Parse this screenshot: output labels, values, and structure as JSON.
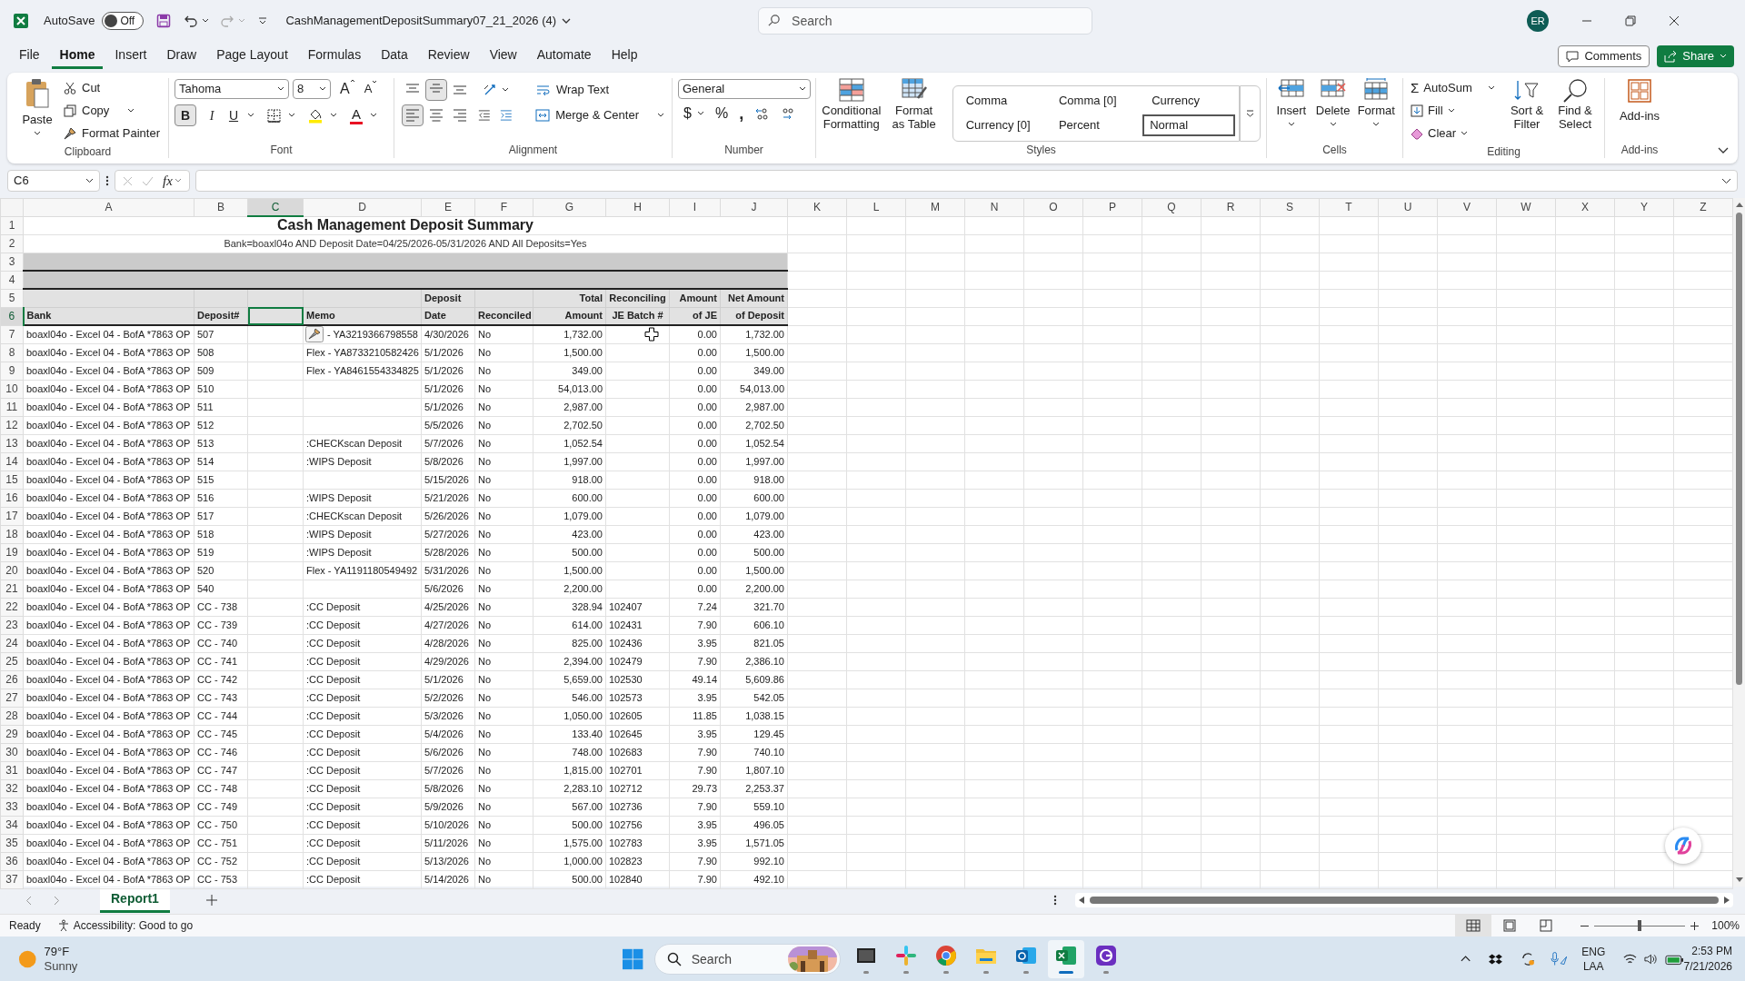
{
  "title_bar": {
    "autosave_label": "AutoSave",
    "autosave_state": "Off",
    "autosave_on": false,
    "file_name": "CashManagementDepositSummary07_21_2026 (4)",
    "search_placeholder": "Search",
    "user_initials": "ER"
  },
  "menu_tabs": [
    {
      "label": "File",
      "selected": false
    },
    {
      "label": "Home",
      "selected": true
    },
    {
      "label": "Insert",
      "selected": false
    },
    {
      "label": "Draw",
      "selected": false
    },
    {
      "label": "Page Layout",
      "selected": false
    },
    {
      "label": "Formulas",
      "selected": false
    },
    {
      "label": "Data",
      "selected": false
    },
    {
      "label": "Review",
      "selected": false
    },
    {
      "label": "View",
      "selected": false
    },
    {
      "label": "Automate",
      "selected": false
    },
    {
      "label": "Help",
      "selected": false
    }
  ],
  "header_buttons": {
    "comments": "Comments",
    "share": "Share"
  },
  "ribbon": {
    "clipboard": {
      "label": "Clipboard",
      "paste": "Paste",
      "cut": "Cut",
      "copy": "Copy",
      "format_painter": "Format Painter"
    },
    "font": {
      "label": "Font",
      "font_name": "Tahoma",
      "font_size": "8",
      "grow_glyph": "A",
      "shrink_glyph": "A",
      "bold": {
        "glyph": "B",
        "on": true
      },
      "italic_glyph": "I",
      "underline_glyph": "U",
      "color_glyph": "A"
    },
    "alignment": {
      "label": "Alignment",
      "vertical_align": [
        {
          "selected": false
        },
        {
          "selected": true
        },
        {
          "selected": false
        }
      ],
      "horizontal_align": [
        {
          "selected": true
        },
        {
          "selected": false
        },
        {
          "selected": false
        }
      ],
      "wrap_text": "Wrap Text",
      "merge_center": "Merge & Center"
    },
    "number": {
      "label": "Number",
      "format": "General",
      "currency_glyph": "$",
      "percent_glyph": "%",
      "comma_glyph": ","
    },
    "styles": {
      "label": "Styles",
      "conditional_formatting": "Conditional Formatting",
      "format_as_table": "Format as Table",
      "gallery": [
        {
          "label": "Comma",
          "selected": false
        },
        {
          "label": "Comma [0]",
          "selected": false
        },
        {
          "label": "Currency",
          "selected": false
        },
        {
          "label": "Currency [0]",
          "selected": false
        },
        {
          "label": "Percent",
          "selected": false
        },
        {
          "label": "Normal",
          "selected": true
        }
      ]
    },
    "cells": {
      "label": "Cells",
      "insert": "Insert",
      "delete": "Delete",
      "format": "Format"
    },
    "editing": {
      "label": "Editing",
      "autosum_glyph": "Σ",
      "autosum": "AutoSum",
      "fill": "Fill",
      "clear": "Clear",
      "sort_filter": "Sort & Filter",
      "find_select": "Find & Select"
    },
    "add_ins": {
      "label": "Add-ins",
      "add_ins": "Add-ins"
    }
  },
  "formula_bar": {
    "name_box": "C6",
    "fx_glyph": "fx"
  },
  "columns": [
    {
      "label": "A",
      "selected": false
    },
    {
      "label": "B",
      "selected": false
    },
    {
      "label": "C",
      "selected": true
    },
    {
      "label": "D",
      "selected": false
    },
    {
      "label": "E",
      "selected": false
    },
    {
      "label": "F",
      "selected": false
    },
    {
      "label": "G",
      "selected": false
    },
    {
      "label": "H",
      "selected": false
    },
    {
      "label": "I",
      "selected": false
    },
    {
      "label": "J",
      "selected": false
    },
    {
      "label": "K",
      "selected": false
    },
    {
      "label": "L",
      "selected": false
    },
    {
      "label": "M",
      "selected": false
    },
    {
      "label": "N",
      "selected": false
    },
    {
      "label": "O",
      "selected": false
    },
    {
      "label": "P",
      "selected": false
    },
    {
      "label": "Q",
      "selected": false
    },
    {
      "label": "R",
      "selected": false
    },
    {
      "label": "S",
      "selected": false
    },
    {
      "label": "T",
      "selected": false
    },
    {
      "label": "U",
      "selected": false
    },
    {
      "label": "V",
      "selected": false
    },
    {
      "label": "W",
      "selected": false
    },
    {
      "label": "X",
      "selected": false
    },
    {
      "label": "Y",
      "selected": false
    },
    {
      "label": "Z",
      "selected": false
    }
  ],
  "rows": [
    {
      "kind": "title",
      "n": "1",
      "selected": false,
      "text": "Cash Management Deposit Summary"
    },
    {
      "kind": "subtitle",
      "n": "2",
      "selected": false,
      "text": "Bank=boaxl04o  AND Deposit Date=04/25/2026-05/31/2026  AND All Deposits=Yes"
    },
    {
      "kind": "band",
      "n": "3",
      "selected": false
    },
    {
      "kind": "band",
      "n": "4",
      "selected": false
    },
    {
      "kind": "header",
      "n": "5",
      "selected": false,
      "e": "Deposit",
      "g": "Total",
      "h": "Reconciling",
      "i": "Amount",
      "j": "Net Amount"
    },
    {
      "kind": "header",
      "n": "6",
      "selected": true,
      "a": "Bank",
      "b": "Deposit#",
      "d": "Memo",
      "e": "Date",
      "f": "Reconciled",
      "g": "Amount",
      "h": "JE Batch #",
      "i": "of JE",
      "j": "of Deposit"
    },
    {
      "kind": "data",
      "n": "7",
      "selected": false,
      "memo_icon": true,
      "a": "boaxl04o - Excel 04 - BofA *7863 OP",
      "b": "507",
      "d": "- YA3219366798558",
      "e": "4/30/2026",
      "f": "No",
      "g": "1,732.00",
      "i": "0.00",
      "j": "1,732.00"
    },
    {
      "kind": "data",
      "n": "8",
      "selected": false,
      "a": "boaxl04o - Excel 04 - BofA *7863 OP",
      "b": "508",
      "d": "Flex - YA8733210582426",
      "e": "5/1/2026",
      "f": "No",
      "g": "1,500.00",
      "i": "0.00",
      "j": "1,500.00"
    },
    {
      "kind": "data",
      "n": "9",
      "selected": false,
      "a": "boaxl04o - Excel 04 - BofA *7863 OP",
      "b": "509",
      "d": "Flex - YA8461554334825",
      "e": "5/1/2026",
      "f": "No",
      "g": "349.00",
      "i": "0.00",
      "j": "349.00"
    },
    {
      "kind": "data",
      "n": "10",
      "selected": false,
      "a": "boaxl04o - Excel 04 - BofA *7863 OP",
      "b": "510",
      "e": "5/1/2026",
      "f": "No",
      "g": "54,013.00",
      "i": "0.00",
      "j": "54,013.00"
    },
    {
      "kind": "data",
      "n": "11",
      "selected": false,
      "a": "boaxl04o - Excel 04 - BofA *7863 OP",
      "b": "511",
      "e": "5/1/2026",
      "f": "No",
      "g": "2,987.00",
      "i": "0.00",
      "j": "2,987.00"
    },
    {
      "kind": "data",
      "n": "12",
      "selected": false,
      "a": "boaxl04o - Excel 04 - BofA *7863 OP",
      "b": "512",
      "e": "5/5/2026",
      "f": "No",
      "g": "2,702.50",
      "i": "0.00",
      "j": "2,702.50"
    },
    {
      "kind": "data",
      "n": "13",
      "selected": false,
      "a": "boaxl04o - Excel 04 - BofA *7863 OP",
      "b": "513",
      "d": ":CHECKscan Deposit",
      "e": "5/7/2026",
      "f": "No",
      "g": "1,052.54",
      "i": "0.00",
      "j": "1,052.54"
    },
    {
      "kind": "data",
      "n": "14",
      "selected": false,
      "a": "boaxl04o - Excel 04 - BofA *7863 OP",
      "b": "514",
      "d": ":WIPS Deposit",
      "e": "5/8/2026",
      "f": "No",
      "g": "1,997.00",
      "i": "0.00",
      "j": "1,997.00"
    },
    {
      "kind": "data",
      "n": "15",
      "selected": false,
      "a": "boaxl04o - Excel 04 - BofA *7863 OP",
      "b": "515",
      "e": "5/15/2026",
      "f": "No",
      "g": "918.00",
      "i": "0.00",
      "j": "918.00"
    },
    {
      "kind": "data",
      "n": "16",
      "selected": false,
      "a": "boaxl04o - Excel 04 - BofA *7863 OP",
      "b": "516",
      "d": ":WIPS Deposit",
      "e": "5/21/2026",
      "f": "No",
      "g": "600.00",
      "i": "0.00",
      "j": "600.00"
    },
    {
      "kind": "data",
      "n": "17",
      "selected": false,
      "a": "boaxl04o - Excel 04 - BofA *7863 OP",
      "b": "517",
      "d": ":CHECKscan Deposit",
      "e": "5/26/2026",
      "f": "No",
      "g": "1,079.00",
      "i": "0.00",
      "j": "1,079.00"
    },
    {
      "kind": "data",
      "n": "18",
      "selected": false,
      "a": "boaxl04o - Excel 04 - BofA *7863 OP",
      "b": "518",
      "d": ":WIPS Deposit",
      "e": "5/27/2026",
      "f": "No",
      "g": "423.00",
      "i": "0.00",
      "j": "423.00"
    },
    {
      "kind": "data",
      "n": "19",
      "selected": false,
      "a": "boaxl04o - Excel 04 - BofA *7863 OP",
      "b": "519",
      "d": ":WIPS Deposit",
      "e": "5/28/2026",
      "f": "No",
      "g": "500.00",
      "i": "0.00",
      "j": "500.00"
    },
    {
      "kind": "data",
      "n": "20",
      "selected": false,
      "a": "boaxl04o - Excel 04 - BofA *7863 OP",
      "b": "520",
      "d": "Flex - YA1191180549492",
      "e": "5/31/2026",
      "f": "No",
      "g": "1,500.00",
      "i": "0.00",
      "j": "1,500.00"
    },
    {
      "kind": "data",
      "n": "21",
      "selected": false,
      "a": "boaxl04o - Excel 04 - BofA *7863 OP",
      "b": "540",
      "e": "5/6/2026",
      "f": "No",
      "g": "2,200.00",
      "i": "0.00",
      "j": "2,200.00"
    },
    {
      "kind": "data",
      "n": "22",
      "selected": false,
      "a": "boaxl04o - Excel 04 - BofA *7863 OP",
      "b": "CC - 738",
      "d": ":CC Deposit",
      "e": "4/25/2026",
      "f": "No",
      "g": "328.94",
      "h": "102407",
      "i": "7.24",
      "j": "321.70"
    },
    {
      "kind": "data",
      "n": "23",
      "selected": false,
      "a": "boaxl04o - Excel 04 - BofA *7863 OP",
      "b": "CC - 739",
      "d": ":CC Deposit",
      "e": "4/27/2026",
      "f": "No",
      "g": "614.00",
      "h": "102431",
      "i": "7.90",
      "j": "606.10"
    },
    {
      "kind": "data",
      "n": "24",
      "selected": false,
      "a": "boaxl04o - Excel 04 - BofA *7863 OP",
      "b": "CC - 740",
      "d": ":CC Deposit",
      "e": "4/28/2026",
      "f": "No",
      "g": "825.00",
      "h": "102436",
      "i": "3.95",
      "j": "821.05"
    },
    {
      "kind": "data",
      "n": "25",
      "selected": false,
      "a": "boaxl04o - Excel 04 - BofA *7863 OP",
      "b": "CC - 741",
      "d": ":CC Deposit",
      "e": "4/29/2026",
      "f": "No",
      "g": "2,394.00",
      "h": "102479",
      "i": "7.90",
      "j": "2,386.10"
    },
    {
      "kind": "data",
      "n": "26",
      "selected": false,
      "a": "boaxl04o - Excel 04 - BofA *7863 OP",
      "b": "CC - 742",
      "d": ":CC Deposit",
      "e": "5/1/2026",
      "f": "No",
      "g": "5,659.00",
      "h": "102530",
      "i": "49.14",
      "j": "5,609.86"
    },
    {
      "kind": "data",
      "n": "27",
      "selected": false,
      "a": "boaxl04o - Excel 04 - BofA *7863 OP",
      "b": "CC - 743",
      "d": ":CC Deposit",
      "e": "5/2/2026",
      "f": "No",
      "g": "546.00",
      "h": "102573",
      "i": "3.95",
      "j": "542.05"
    },
    {
      "kind": "data",
      "n": "28",
      "selected": false,
      "a": "boaxl04o - Excel 04 - BofA *7863 OP",
      "b": "CC - 744",
      "d": ":CC Deposit",
      "e": "5/3/2026",
      "f": "No",
      "g": "1,050.00",
      "h": "102605",
      "i": "11.85",
      "j": "1,038.15"
    },
    {
      "kind": "data",
      "n": "29",
      "selected": false,
      "a": "boaxl04o - Excel 04 - BofA *7863 OP",
      "b": "CC - 745",
      "d": ":CC Deposit",
      "e": "5/4/2026",
      "f": "No",
      "g": "133.40",
      "h": "102645",
      "i": "3.95",
      "j": "129.45"
    },
    {
      "kind": "data",
      "n": "30",
      "selected": false,
      "a": "boaxl04o - Excel 04 - BofA *7863 OP",
      "b": "CC - 746",
      "d": ":CC Deposit",
      "e": "5/6/2026",
      "f": "No",
      "g": "748.00",
      "h": "102683",
      "i": "7.90",
      "j": "740.10"
    },
    {
      "kind": "data",
      "n": "31",
      "selected": false,
      "a": "boaxl04o - Excel 04 - BofA *7863 OP",
      "b": "CC - 747",
      "d": ":CC Deposit",
      "e": "5/7/2026",
      "f": "No",
      "g": "1,815.00",
      "h": "102701",
      "i": "7.90",
      "j": "1,807.10"
    },
    {
      "kind": "data",
      "n": "32",
      "selected": false,
      "a": "boaxl04o - Excel 04 - BofA *7863 OP",
      "b": "CC - 748",
      "d": ":CC Deposit",
      "e": "5/8/2026",
      "f": "No",
      "g": "2,283.10",
      "h": "102712",
      "i": "29.73",
      "j": "2,253.37"
    },
    {
      "kind": "data",
      "n": "33",
      "selected": false,
      "a": "boaxl04o - Excel 04 - BofA *7863 OP",
      "b": "CC - 749",
      "d": ":CC Deposit",
      "e": "5/9/2026",
      "f": "No",
      "g": "567.00",
      "h": "102736",
      "i": "7.90",
      "j": "559.10"
    },
    {
      "kind": "data",
      "n": "34",
      "selected": false,
      "a": "boaxl04o - Excel 04 - BofA *7863 OP",
      "b": "CC - 750",
      "d": ":CC Deposit",
      "e": "5/10/2026",
      "f": "No",
      "g": "500.00",
      "h": "102756",
      "i": "3.95",
      "j": "496.05"
    },
    {
      "kind": "data",
      "n": "35",
      "selected": false,
      "a": "boaxl04o - Excel 04 - BofA *7863 OP",
      "b": "CC - 751",
      "d": ":CC Deposit",
      "e": "5/11/2026",
      "f": "No",
      "g": "1,575.00",
      "h": "102783",
      "i": "3.95",
      "j": "1,571.05"
    },
    {
      "kind": "data",
      "n": "36",
      "selected": false,
      "a": "boaxl04o - Excel 04 - BofA *7863 OP",
      "b": "CC - 752",
      "d": ":CC Deposit",
      "e": "5/13/2026",
      "f": "No",
      "g": "1,000.00",
      "h": "102823",
      "i": "7.90",
      "j": "992.10"
    },
    {
      "kind": "data",
      "n": "37",
      "selected": false,
      "a": "boaxl04o - Excel 04 - BofA *7863 OP",
      "b": "CC - 753",
      "d": ":CC Deposit",
      "e": "5/14/2026",
      "f": "No",
      "g": "500.00",
      "h": "102840",
      "i": "7.90",
      "j": "492.10"
    }
  ],
  "sheet_tabs": [
    {
      "label": "Report1",
      "selected": true
    }
  ],
  "status_bar": {
    "ready": "Ready",
    "accessibility": "Accessibility: Good to go",
    "views": [
      {
        "selected": true
      },
      {
        "selected": false
      },
      {
        "selected": false
      }
    ],
    "zoom": {
      "level": 0.5,
      "label": "100%"
    }
  },
  "taskbar": {
    "weather_temp": "79°F",
    "weather_text": "Sunny",
    "search_placeholder": "Search",
    "apps": [
      {
        "kind": "dark-app",
        "selected": false
      },
      {
        "kind": "slack",
        "selected": false
      },
      {
        "kind": "chrome",
        "selected": false
      },
      {
        "kind": "folder",
        "selected": false
      },
      {
        "kind": "outlook",
        "selected": false
      },
      {
        "kind": "excel",
        "selected": true
      },
      {
        "kind": "purple-app",
        "selected": false
      }
    ],
    "lang": "ENG",
    "layout": "LAA",
    "time": "2:53 PM",
    "date": "7/21/2026"
  }
}
